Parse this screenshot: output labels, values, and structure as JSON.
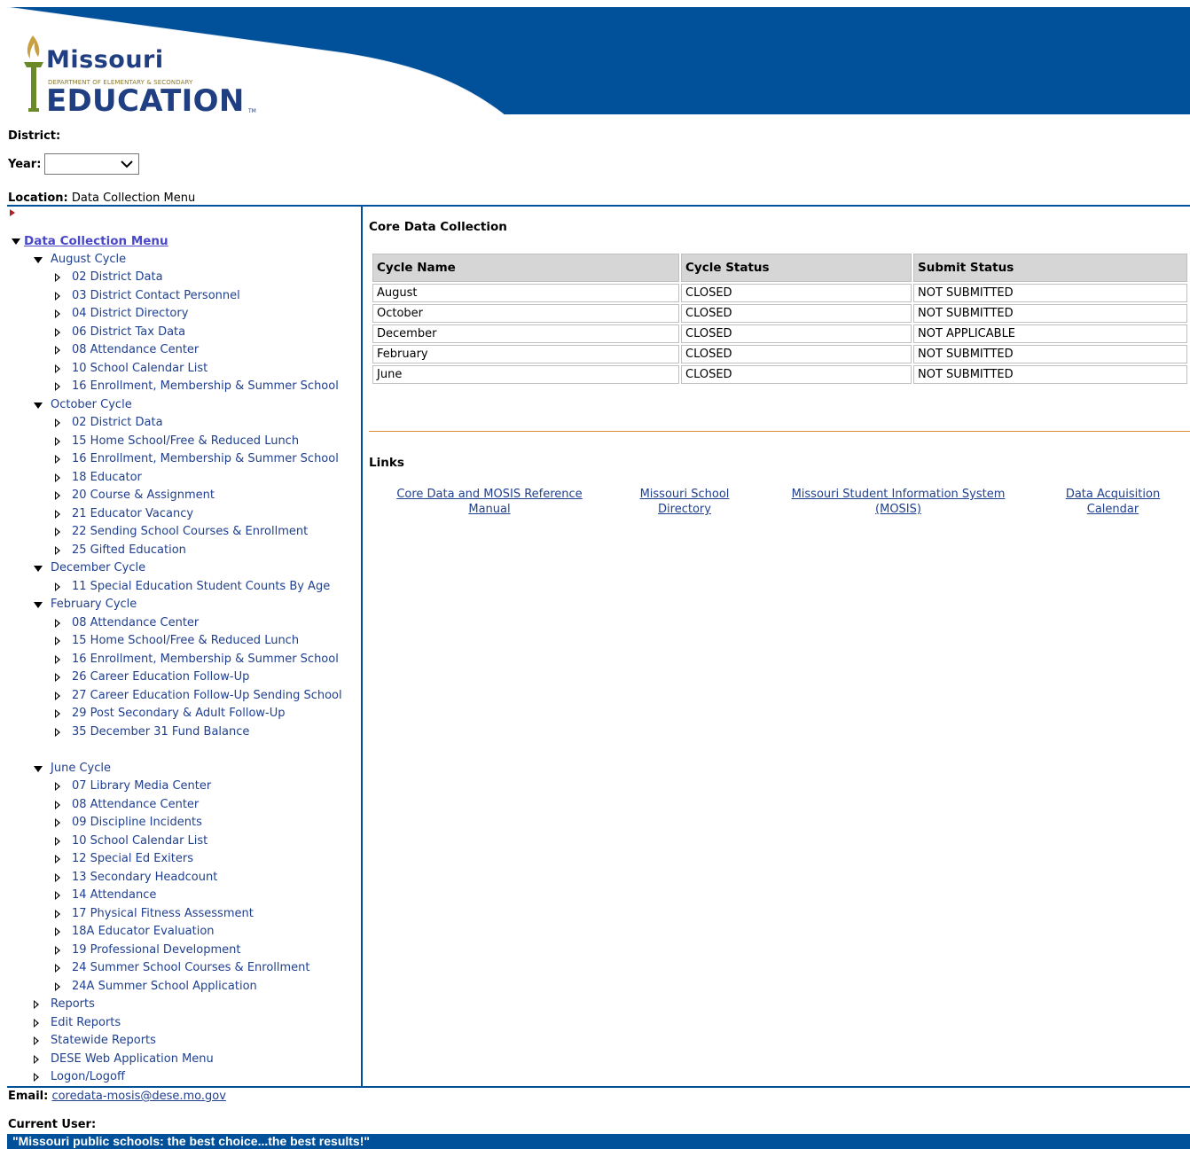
{
  "header": {
    "logo_title": "Missouri",
    "logo_subtitle": "DEPARTMENT OF ELEMENTARY & SECONDARY",
    "logo_main": "EDUCATION",
    "logo_tm": "TM",
    "colors": {
      "banner": "#00509a",
      "logo_text": "#1f3f82"
    }
  },
  "district_label": "District:",
  "year_label": "Year:",
  "year_value": "",
  "location_label": "Location:",
  "location_value": "Data Collection Menu",
  "tree": {
    "root": "Data Collection Menu",
    "august": {
      "label": "August Cycle",
      "items": [
        "02 District Data",
        "03 District Contact Personnel",
        "04 District Directory",
        "06 District Tax Data",
        "08 Attendance Center",
        "10 School Calendar List",
        "16 Enrollment, Membership & Summer School"
      ]
    },
    "october": {
      "label": "October Cycle",
      "items": [
        "02 District Data",
        "15 Home School/Free & Reduced Lunch",
        "16 Enrollment, Membership & Summer School",
        "18 Educator",
        "20 Course & Assignment",
        "21 Educator Vacancy",
        "22 Sending School Courses & Enrollment",
        "25 Gifted Education"
      ]
    },
    "december": {
      "label": "December Cycle",
      "items": [
        "11 Special Education Student Counts By Age"
      ]
    },
    "february": {
      "label": "February Cycle",
      "items": [
        "08 Attendance Center",
        "15 Home School/Free & Reduced Lunch",
        "16 Enrollment, Membership & Summer School",
        "26 Career Education Follow-Up",
        "27 Career Education Follow-Up Sending School",
        "29 Post Secondary & Adult Follow-Up",
        "35 December 31 Fund Balance"
      ]
    },
    "june": {
      "label": "June Cycle",
      "items": [
        "07 Library Media Center",
        "08 Attendance Center",
        "09 Discipline Incidents",
        "10 School Calendar List",
        "12 Special Ed Exiters",
        "13 Secondary Headcount",
        "14 Attendance",
        "17 Physical Fitness Assessment",
        "18A Educator Evaluation",
        "19 Professional Development",
        "24 Summer School Courses & Enrollment",
        "24A Summer School Application"
      ]
    },
    "other": [
      "Reports",
      "Edit Reports",
      "Statewide Reports",
      "DESE Web Application Menu",
      "Logon/Logoff"
    ]
  },
  "content": {
    "title": "Core Data Collection",
    "table": {
      "headers": [
        "Cycle Name",
        "Cycle Status",
        "Submit Status"
      ],
      "rows": [
        [
          "August",
          "CLOSED",
          "NOT SUBMITTED"
        ],
        [
          "October",
          "CLOSED",
          "NOT SUBMITTED"
        ],
        [
          "December",
          "CLOSED",
          "NOT APPLICABLE"
        ],
        [
          "February",
          "CLOSED",
          "NOT SUBMITTED"
        ],
        [
          "June",
          "CLOSED",
          "NOT SUBMITTED"
        ]
      ]
    },
    "links_title": "Links",
    "links": [
      {
        "line1": "Core Data and MOSIS Reference",
        "line2": "Manual"
      },
      {
        "line1": "Missouri School",
        "line2": "Directory"
      },
      {
        "line1": "Missouri Student Information System",
        "line2": "(MOSIS)"
      },
      {
        "line1": "Data Acquisition",
        "line2": "Calendar"
      }
    ]
  },
  "footer": {
    "email_label": "Email:",
    "email_value": "coredata-mosis@dese.mo.gov",
    "current_user_label": "Current User:",
    "motto": "\"Missouri public schools: the best choice...the best results!\""
  }
}
